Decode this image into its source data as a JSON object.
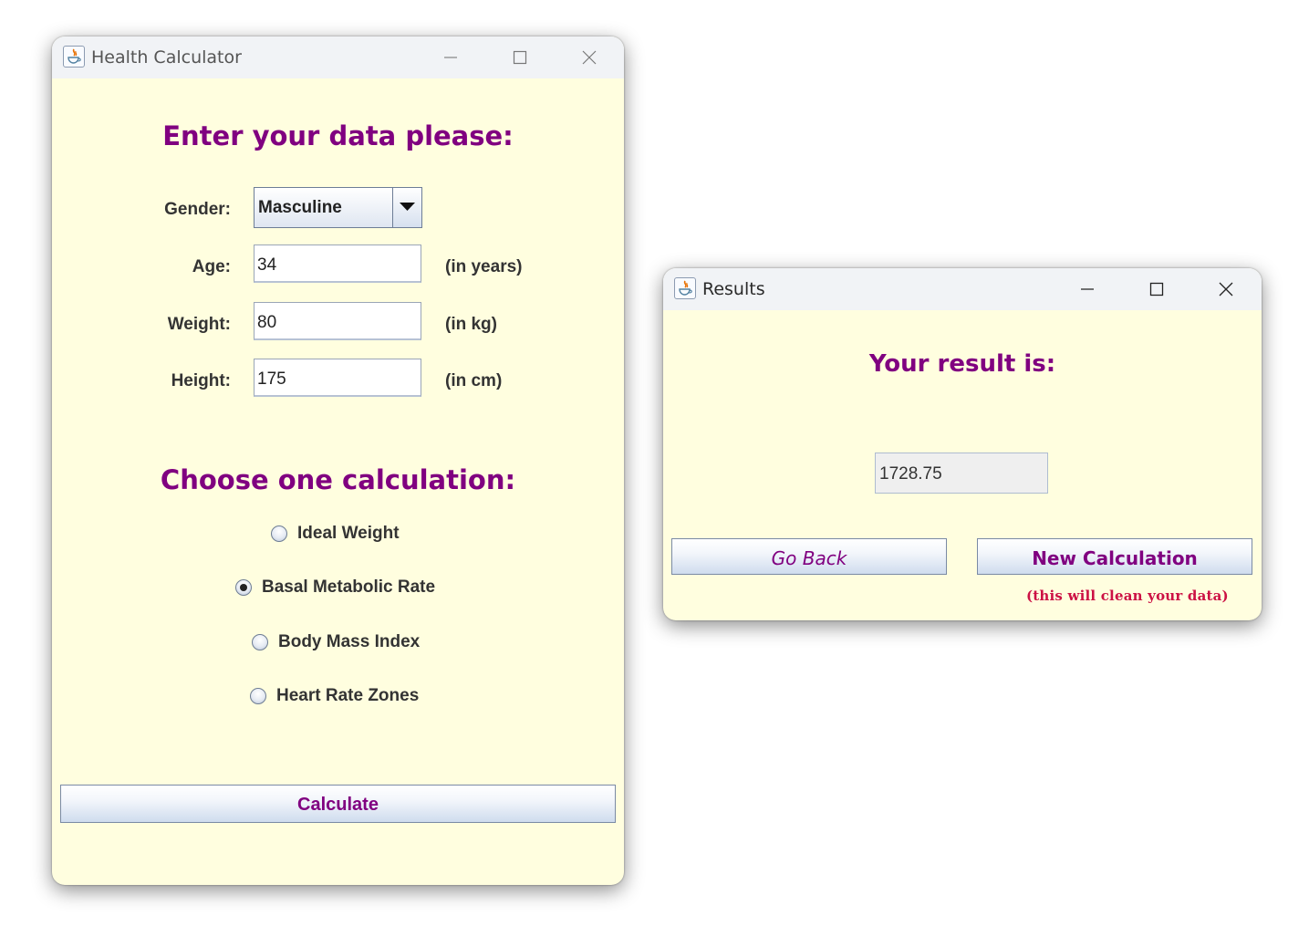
{
  "main_window": {
    "title": "Health Calculator",
    "heading": "Enter your data please:",
    "gender": {
      "label": "Gender:",
      "value": "Masculine"
    },
    "age": {
      "label": "Age:",
      "value": "34",
      "unit": "(in years)"
    },
    "weight": {
      "label": "Weight:",
      "value": "80",
      "unit": "(in kg)"
    },
    "height": {
      "label": "Height:",
      "value": "175",
      "unit": "(in cm)"
    },
    "calc_heading": "Choose one calculation:",
    "options": [
      {
        "label": "Ideal Weight",
        "selected": false
      },
      {
        "label": "Basal Metabolic Rate",
        "selected": true
      },
      {
        "label": "Body Mass Index",
        "selected": false
      },
      {
        "label": "Heart Rate Zones",
        "selected": false
      }
    ],
    "calculate_label": "Calculate"
  },
  "results_window": {
    "title": "Results",
    "heading": "Your result is:",
    "result_value": "1728.75",
    "go_back_label": "Go Back",
    "new_calc_label": "New Calculation",
    "note": "(this will clean your data)"
  },
  "colors": {
    "heading": "#800080",
    "background": "#fffedf",
    "note": "#cc1144"
  },
  "icons": [
    "java-app-icon",
    "minimize-icon",
    "maximize-icon",
    "close-icon",
    "dropdown-arrow-icon"
  ]
}
